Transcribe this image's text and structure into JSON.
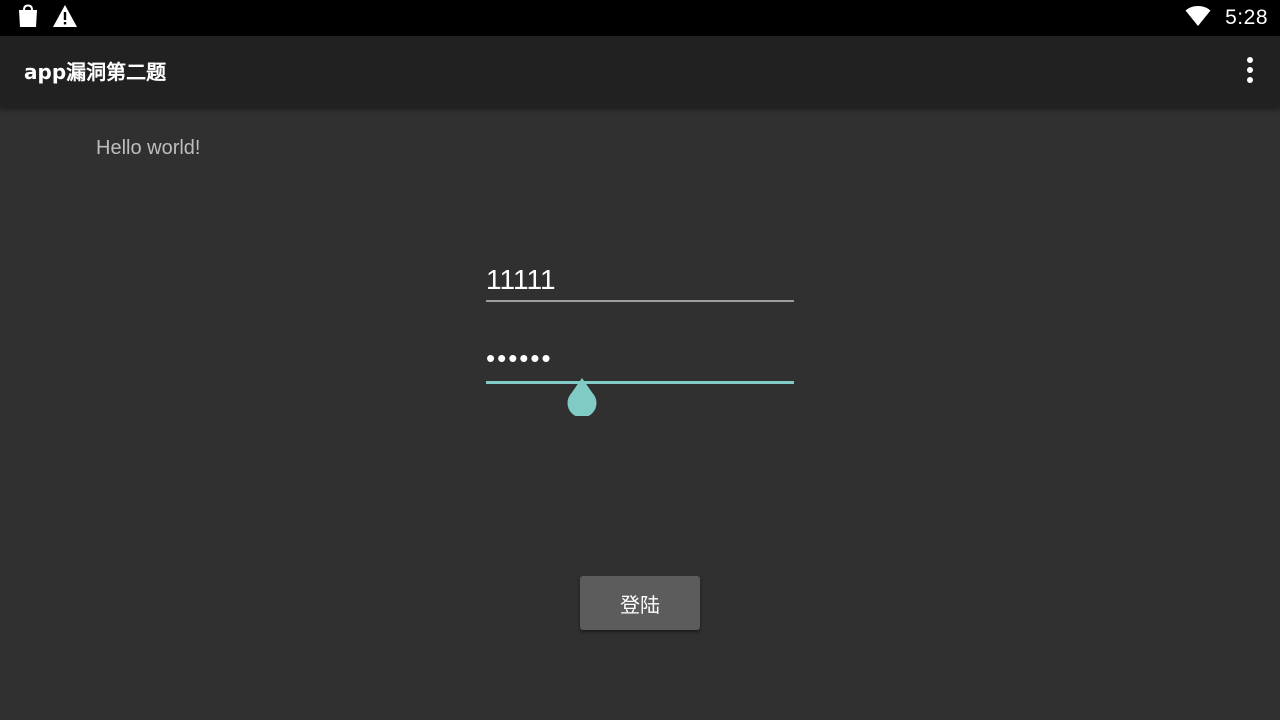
{
  "status_bar": {
    "time": "5:28",
    "left_icons": [
      "shopping-bag-icon",
      "warning-icon"
    ],
    "right_icons": [
      "wifi-icon"
    ]
  },
  "app_bar": {
    "title": "app漏洞第二题",
    "overflow_icon": "more-vert-icon"
  },
  "content": {
    "hello_text": "Hello world!",
    "username_value": "11111",
    "password_value": "••••••",
    "login_button_label": "登陆"
  },
  "colors": {
    "status_bar_bg": "#000000",
    "app_bar_bg": "#212121",
    "background": "#303030",
    "accent": "#80cbc4",
    "button_bg": "#5c5c5c",
    "text_primary": "#ffffff",
    "text_secondary": "#bdbdbd"
  }
}
